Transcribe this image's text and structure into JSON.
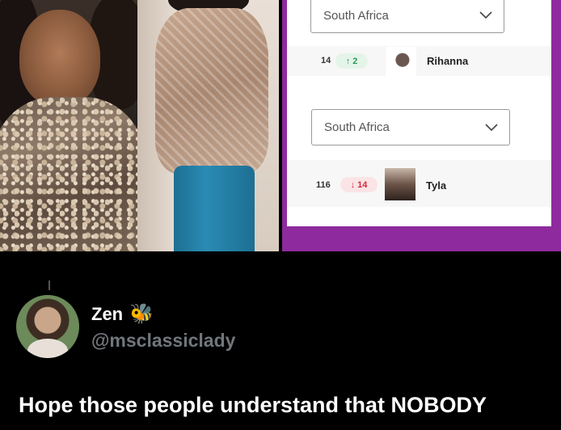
{
  "chart_screenshot": {
    "rows": [
      {
        "country_select": "South Africa",
        "rank": "14",
        "movement": "2",
        "movement_direction": "up",
        "artist": "Rihanna"
      },
      {
        "country_select": "South Africa",
        "rank": "116",
        "movement": "14",
        "movement_direction": "down",
        "artist": "Tyla"
      }
    ],
    "frame_color": "#8e2a9e",
    "up_color": "#2a9a56",
    "down_color": "#d2283a"
  },
  "tweet": {
    "display_name": "Zen",
    "name_emoji": "🐝",
    "handle": "@msclassiclady",
    "text": "Hope those people understand that NOBODY"
  },
  "icons": {
    "up_arrow": "↑",
    "down_arrow": "↓",
    "chevron": "chevron-down-icon"
  }
}
